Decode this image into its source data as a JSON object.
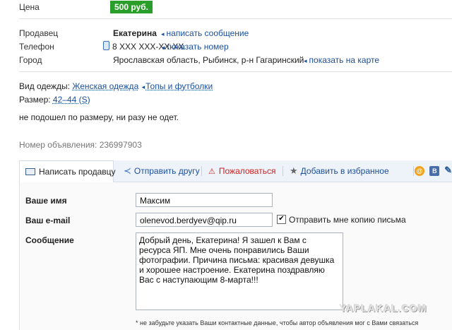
{
  "price": {
    "label": "Цена",
    "value": "500 руб."
  },
  "seller": {
    "label": "Продавец",
    "name": "Екатерина",
    "action": "написать сообщение"
  },
  "phone": {
    "label": "Телефон",
    "value": "8 XXX XXX-XX-XX",
    "action": "показать номер"
  },
  "city": {
    "label": "Город",
    "value": "Ярославская область, Рыбинск, р-н Гагаринский",
    "action": "показать на карте"
  },
  "category": {
    "label": "Вид одежды:",
    "main": "Женская одежда",
    "sub": "Топы и футболки"
  },
  "size": {
    "label": "Размер:",
    "value": "42–44 (S)"
  },
  "description": "не подошел по размеру, ни разу не одет.",
  "ad_number": "Номер объявления: 236997903",
  "tabs": [
    {
      "label": "Написать продавцу",
      "icon": "envelope-icon"
    },
    {
      "label": "Отправить другу",
      "icon": "share-icon"
    },
    {
      "label": "Пожаловаться",
      "icon": "warning-icon"
    },
    {
      "label": "Добавить в избранное",
      "icon": "star-icon"
    }
  ],
  "social_icons": [
    "mail-agent-icon",
    "vk-icon",
    "livejournal-icon"
  ],
  "form": {
    "name_label": "Ваше имя",
    "name_value": "Максим",
    "email_label": "Ваш e-mail",
    "email_value": "olenevod.berdyev@qip.ru",
    "copy_label": "Отправить мне копию письма",
    "copy_checked": true,
    "message_label": "Сообщение",
    "message_value": "Добрый день, Екатерина! Я зашел к Вам с ресурса ЯП. Мне очень понравились Ваши фотографии. Причина письма: красивая девушка и хорошее настроение. Екатерина поздравляю Вас с наступающим 8-марта!!!",
    "note": "* не забудьте указать Ваши контактные данные, чтобы автор объявления мог с Вами связаться"
  },
  "watermark": "YAPLAKAL.COM",
  "colors": {
    "price_bg": "#2a9e2a",
    "link": "#1a4f9c",
    "warning": "#cc2222"
  }
}
